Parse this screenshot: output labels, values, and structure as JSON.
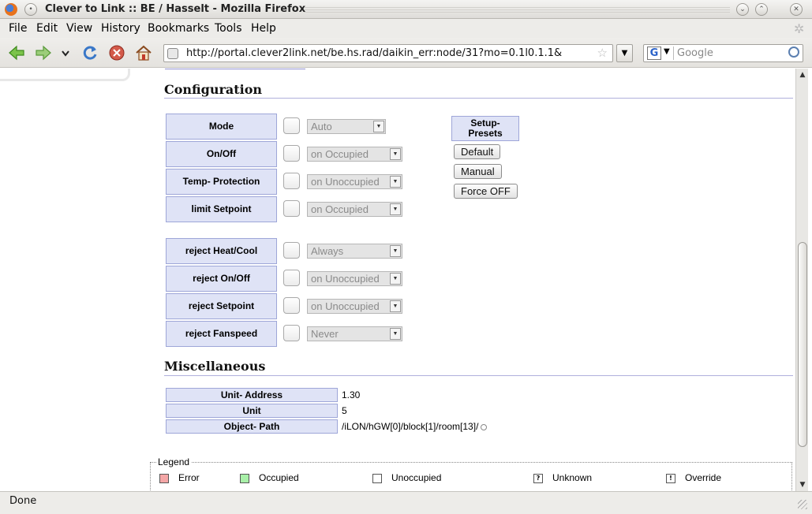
{
  "window": {
    "title": "Clever to Link :: BE / Hasselt - Mozilla Firefox",
    "minimize_icon": "chevron-down-icon",
    "maximize_icon": "chevron-up-icon",
    "close_icon": "close-icon"
  },
  "menubar": {
    "items": [
      "File",
      "Edit",
      "View",
      "History",
      "Bookmarks",
      "Tools",
      "Help"
    ]
  },
  "navbar": {
    "url": "http://portal.clever2link.net/be.hs.rad/daikin_err:node/31?mo=0.1l0.1.1&",
    "search_placeholder": "Google",
    "search_engine_letter": "G"
  },
  "configuration": {
    "heading": "Configuration",
    "rows": [
      {
        "label": "Mode",
        "value": "Auto"
      },
      {
        "label": "On/Off",
        "value": "on Occupied"
      },
      {
        "label": "Temp- Protection",
        "value": "on Unoccupied"
      },
      {
        "label": "limit Setpoint",
        "value": "on Occupied"
      },
      {
        "label": "reject Heat/Cool",
        "value": "Always"
      },
      {
        "label": "reject On/Off",
        "value": "on Unoccupied"
      },
      {
        "label": "reject Setpoint",
        "value": "on Unoccupied"
      },
      {
        "label": "reject Fanspeed",
        "value": "Never"
      }
    ],
    "presets": {
      "title": "Setup- Presets",
      "buttons": [
        "Default",
        "Manual",
        "Force OFF"
      ]
    }
  },
  "miscellaneous": {
    "heading": "Miscellaneous",
    "rows": [
      {
        "label": "Unit- Address",
        "value": "1.30"
      },
      {
        "label": "Unit",
        "value": "5"
      },
      {
        "label": "Object- Path",
        "value": "/iLON/hGW[0]/block[1]/room[13]/"
      }
    ]
  },
  "legend": {
    "title": "Legend",
    "items": [
      {
        "label": "Error",
        "color": "#f4a6a6",
        "symbol": ""
      },
      {
        "label": "Occupied",
        "color": "#a8f0a8",
        "symbol": ""
      },
      {
        "label": "Unoccupied",
        "color": "#ffffff",
        "symbol": ""
      },
      {
        "label": "Unknown",
        "color": "#ffffff",
        "symbol": "?"
      },
      {
        "label": "Override",
        "color": "#ffffff",
        "symbol": "!"
      }
    ]
  },
  "status": {
    "text": "Done"
  }
}
